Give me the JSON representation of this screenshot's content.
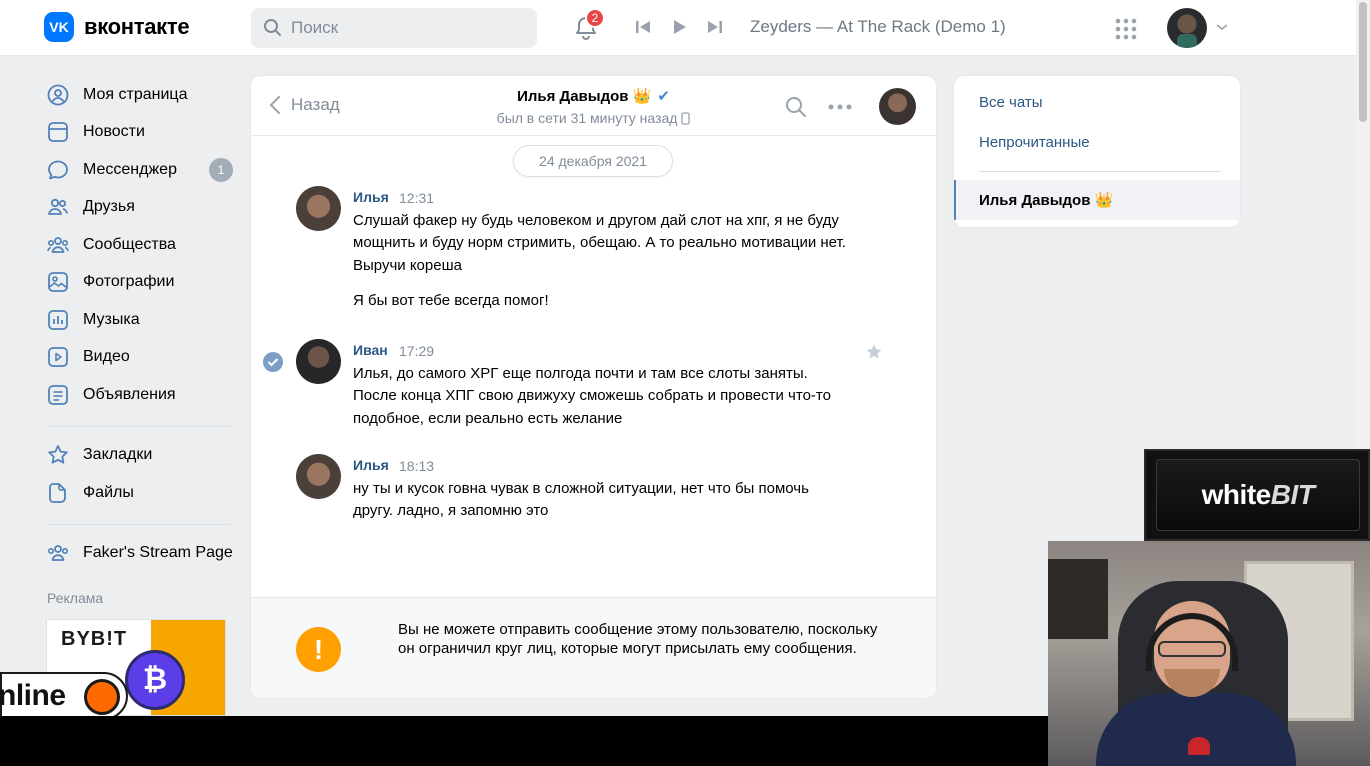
{
  "header": {
    "logo_text": "вконтакте",
    "logo_mark": "VK",
    "search_placeholder": "Поиск",
    "notifications_count": "2",
    "track": "Zeyders — At The Rack (Demo 1)",
    "accent_color": "#0077ff"
  },
  "sidebar": {
    "items": [
      {
        "label": "Моя страница",
        "icon": "user-circle-icon"
      },
      {
        "label": "Новости",
        "icon": "news-icon"
      },
      {
        "label": "Мессенджер",
        "icon": "chat-bubble-icon",
        "counter": "1"
      },
      {
        "label": "Друзья",
        "icon": "friends-icon"
      },
      {
        "label": "Сообщества",
        "icon": "communities-icon"
      },
      {
        "label": "Фотографии",
        "icon": "photo-icon"
      },
      {
        "label": "Музыка",
        "icon": "music-icon"
      },
      {
        "label": "Видео",
        "icon": "video-icon"
      },
      {
        "label": "Объявления",
        "icon": "classifieds-icon"
      }
    ],
    "items2": [
      {
        "label": "Закладки",
        "icon": "star-icon"
      },
      {
        "label": "Файлы",
        "icon": "file-icon"
      }
    ],
    "items3": [
      {
        "label": "Faker's Stream Page",
        "icon": "communities-icon"
      }
    ],
    "ads_label": "Реклама",
    "ad_brand": "BYB!T",
    "ad_coin": "₿"
  },
  "overlay": {
    "online_text": "nline",
    "whitebit_white": "white",
    "whitebit_bit": "BIT"
  },
  "chat": {
    "back_label": "Назад",
    "peer_name": "Илья Давыдов",
    "peer_badge": "👑",
    "verified": "✔",
    "peer_status": "был в сети 31 минуту назад",
    "date": "24 декабря 2021",
    "messages": [
      {
        "author": "Илья",
        "time": "12:31",
        "text": "Слушай факер ну будь человеком и другом дай слот на хпг, я не буду мощнить и буду норм стримить, обещаю. А то реально мотивации нет. Выручи кореша",
        "text2": "Я бы вот тебе всегда помог!"
      },
      {
        "author": "Иван",
        "time": "17:29",
        "text": "Илья, до самого ХРГ еще полгода почти и там все слоты заняты. После конца ХПГ свою движуху сможешь собрать и провести что-то подобное, если реально есть желание"
      },
      {
        "author": "Илья",
        "time": "18:13",
        "text": "ну ты и кусок говна чувак в сложной ситуации, нет что бы помочь другу. ладно, я запомню это"
      }
    ],
    "warning_icon": "!",
    "warning_text": "Вы не можете отправить сообщение этому пользователю, поскольку он ограничил круг лиц, которые могут присылать ему сообщения."
  },
  "right_panel": {
    "all_chats": "Все чаты",
    "unread": "Непрочитанные",
    "active_chat": "Илья Давыдов 👑"
  }
}
